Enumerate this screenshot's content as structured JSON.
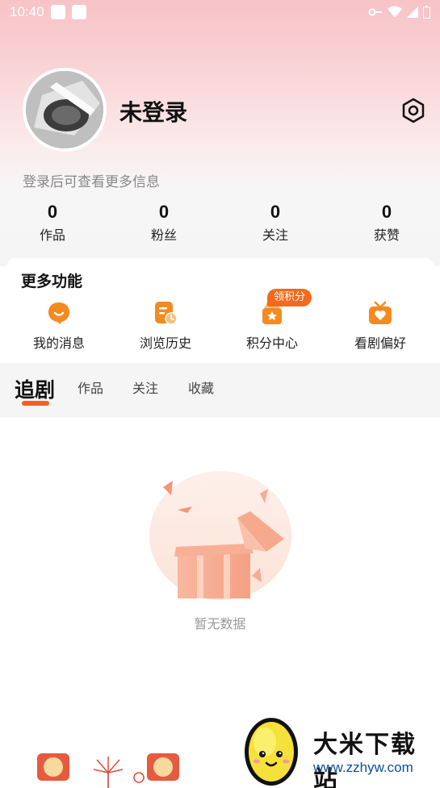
{
  "status_bar": {
    "time": "10:40"
  },
  "profile": {
    "username": "未登录",
    "login_hint": "登录后可查看更多信息"
  },
  "stats": [
    {
      "value": "0",
      "label": "作品"
    },
    {
      "value": "0",
      "label": "粉丝"
    },
    {
      "value": "0",
      "label": "关注"
    },
    {
      "value": "0",
      "label": "获赞"
    }
  ],
  "features": {
    "title": "更多功能",
    "items": [
      {
        "label": "我的消息",
        "icon": "message-icon"
      },
      {
        "label": "浏览历史",
        "icon": "history-icon"
      },
      {
        "label": "积分中心",
        "icon": "points-icon"
      },
      {
        "label": "看剧偏好",
        "icon": "tv-preference-icon"
      }
    ],
    "badge": "领积分"
  },
  "tabs": [
    "追剧",
    "作品",
    "关注",
    "收藏"
  ],
  "empty_state": {
    "text": "暂无数据"
  },
  "watermark": {
    "name": "大米下载站",
    "url": "www.zzhyw.com"
  },
  "colors": {
    "accent": "#f3601f",
    "icon_orange": "#f58a1f"
  }
}
